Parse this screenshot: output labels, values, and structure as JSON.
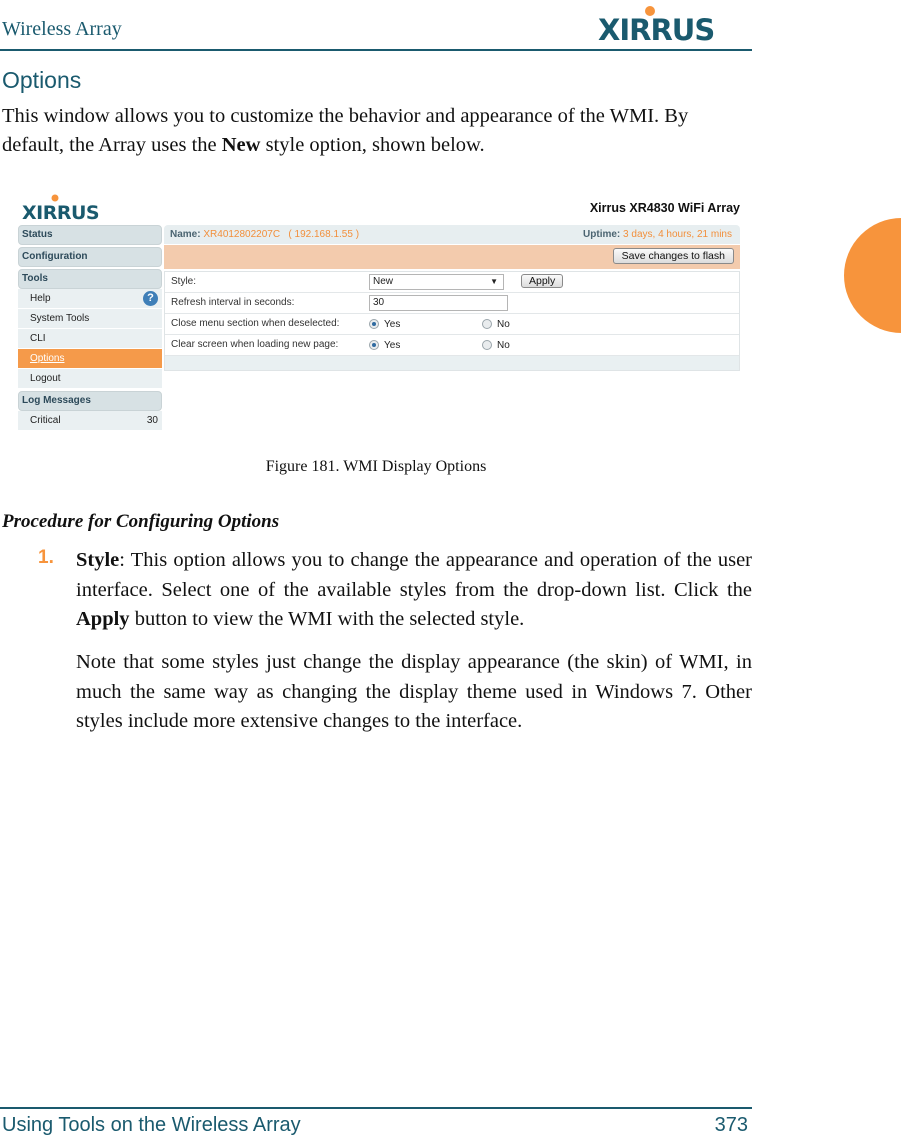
{
  "header": {
    "doc_title": "Wireless Array",
    "brand": "XIRRUS"
  },
  "section": {
    "title": "Options",
    "intro_1": "This window allows you to customize the behavior and appearance of the WMI. By default, the Array uses the ",
    "intro_bold": "New",
    "intro_2": " style option, shown below."
  },
  "figure": {
    "logo": "XIRRUS",
    "product": "Xirrus XR4830 WiFi Array",
    "sidebar": {
      "status": "Status",
      "configuration": "Configuration",
      "tools": "Tools",
      "tools_items": [
        "Help",
        "System Tools",
        "CLI",
        "Options",
        "Logout"
      ],
      "active_item": "Options",
      "log_messages": "Log Messages",
      "log_items": [
        {
          "label": "Critical",
          "count": "30"
        }
      ]
    },
    "infobar": {
      "name_label": "Name:",
      "name_value": "XR4012802207C   ( 192.168.1.55 )",
      "uptime_label": "Uptime:",
      "uptime_value": "3 days, 4 hours, 21 mins"
    },
    "save_button": "Save changes to flash",
    "form": {
      "style_label": "Style:",
      "style_value": "New",
      "apply_button": "Apply",
      "refresh_label": "Refresh interval in seconds:",
      "refresh_value": "30",
      "close_menu_label": "Close menu section when deselected:",
      "clear_screen_label": "Clear screen when loading new page:",
      "yes": "Yes",
      "no": "No",
      "close_menu_selected": "Yes",
      "clear_screen_selected": "Yes"
    },
    "caption": "Figure 181. WMI Display Options"
  },
  "procedure": {
    "title": "Procedure for Configuring Options",
    "step_number": "1.",
    "step_bold": "Style",
    "step_text_1": ": This option allows you to change the appearance and operation of the user interface. Select one of the available styles from the drop-down list. Click the ",
    "step_bold_2": "Apply",
    "step_text_2": " button to view the WMI with the selected style.",
    "note": "Note that some styles just change the display appearance (the skin) of WMI, in much the same way as changing the display theme used in Windows 7. Other styles include more extensive changes to the interface."
  },
  "footer": {
    "chapter": "Using Tools on the Wireless Array",
    "page": "373"
  },
  "colors": {
    "brand_teal": "#1a5a6e",
    "accent_orange": "#f7943c"
  }
}
